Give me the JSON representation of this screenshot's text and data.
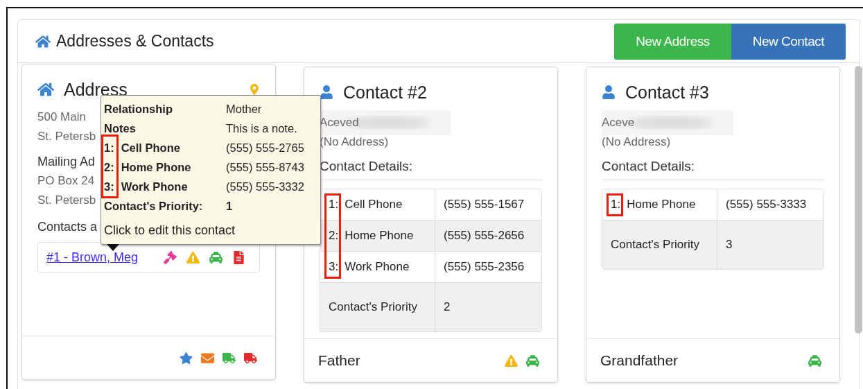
{
  "panel": {
    "title": "Addresses & Contacts",
    "buttons": [
      {
        "label": "New Address",
        "kind": "success"
      },
      {
        "label": "New Contact",
        "kind": "primary"
      }
    ]
  },
  "address_card": {
    "title": "Address",
    "lines": [
      "500 Main",
      "St. Petersb"
    ],
    "mailing_label": "Mailing Ad",
    "mailing_lines": [
      "PO Box 24",
      "St. Petersb"
    ],
    "contacts_label": "Contacts a",
    "contacts": [
      {
        "name": "#1 - Brown, Meg",
        "icons": [
          {
            "kind": "gavel"
          },
          {
            "kind": "warning"
          },
          {
            "kind": "taxi"
          },
          {
            "kind": "file"
          }
        ]
      }
    ],
    "footer_icons": [
      {
        "kind": "star"
      },
      {
        "kind": "mail"
      },
      {
        "kind": "truck-green"
      },
      {
        "kind": "truck-red"
      }
    ]
  },
  "tooltip": {
    "rows": [
      {
        "label": "Relationship",
        "value": "Mother"
      },
      {
        "label": "Notes",
        "value": "This is a note."
      }
    ],
    "phones": [
      {
        "number": "1:",
        "label": "Cell Phone",
        "value": "(555) 555-2765"
      },
      {
        "number": "2:",
        "label": "Home Phone",
        "value": "(555) 555-8743"
      },
      {
        "number": "3:",
        "label": "Work Phone",
        "value": "(555) 555-3332"
      }
    ],
    "numbers_marked": true,
    "priority": {
      "label": "Contact's Priority:",
      "value": "1"
    },
    "hint": "Click to edit this contact"
  },
  "contacts": [
    {
      "title": "Contact #2",
      "name": "Aceved",
      "address": "(No Address)",
      "details_label": "Contact Details:",
      "numbers_marked": true,
      "phones": [
        {
          "number": "1:",
          "label": "Cell Phone",
          "value": "(555) 555-1567"
        },
        {
          "number": "2:",
          "label": "Home Phone",
          "value": "(555) 555-2656"
        },
        {
          "number": "3:",
          "label": "Work Phone",
          "value": "(555) 555-2356"
        }
      ],
      "priority": {
        "label": "Contact's Priority",
        "value": "2"
      },
      "relationship": "Father",
      "icons": [
        {
          "kind": "warning"
        },
        {
          "kind": "taxi"
        }
      ]
    },
    {
      "title": "Contact #3",
      "name": "Aceve",
      "address": "(No Address)",
      "details_label": "Contact Details:",
      "numbers_marked": true,
      "phones": [
        {
          "number": "1:",
          "label": "Home Phone",
          "value": "(555) 555-3333"
        }
      ],
      "priority": {
        "label": "Contact's Priority",
        "value": "3"
      },
      "relationship": "Grandfather",
      "icons": [
        {
          "kind": "taxi"
        }
      ]
    }
  ]
}
